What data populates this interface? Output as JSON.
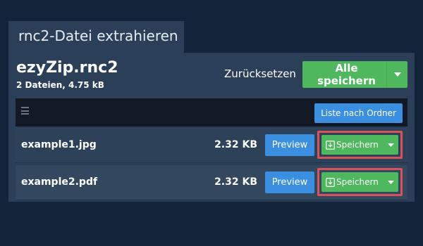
{
  "tab": {
    "title": "rnc2-Datei extrahieren"
  },
  "archive": {
    "name": "ezyZip.rnc2",
    "info": "2 Dateien, 4.75 kB"
  },
  "actions": {
    "reset_label": "Zurücksetzen",
    "save_all_label": "Alle speichern"
  },
  "toolbar": {
    "list_icon": "list-icon",
    "folder_button_label": "Liste nach Ordner"
  },
  "files": [
    {
      "name": "example1.jpg",
      "size": "2.32 KB",
      "preview_label": "Preview",
      "save_label": "Speichern"
    },
    {
      "name": "example2.pdf",
      "size": "2.32 KB",
      "preview_label": "Preview",
      "save_label": "Speichern"
    }
  ],
  "colors": {
    "background": "#12243a",
    "panel": "#2b4058",
    "green": "#4fb75d",
    "blue": "#3b8fe0",
    "highlight": "#d9545a"
  }
}
